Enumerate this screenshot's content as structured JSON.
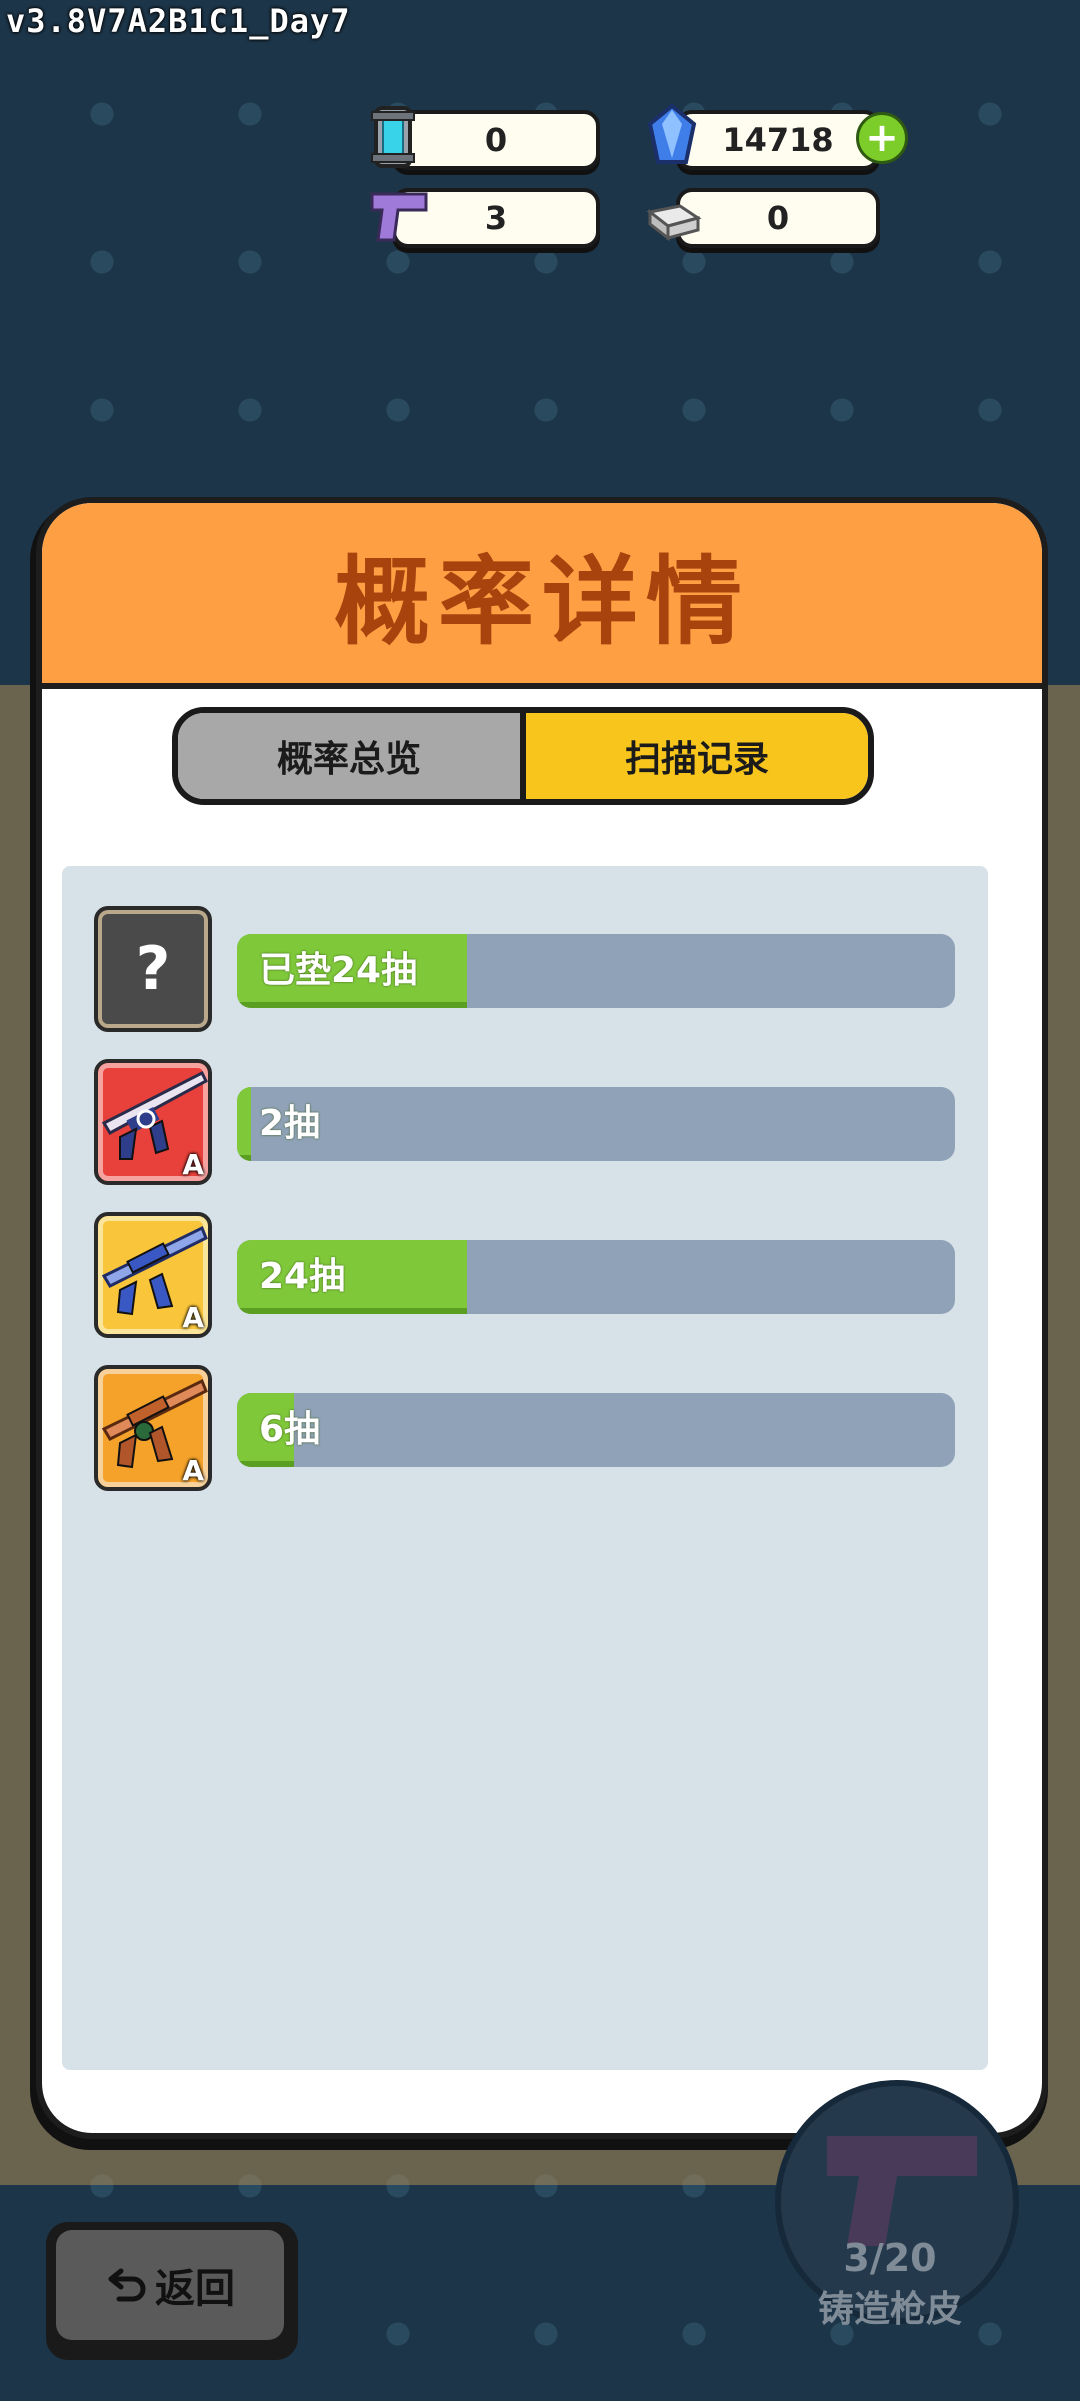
{
  "version": "v3.8V7A2B1C1_Day7",
  "currencies": {
    "capsule": {
      "icon": "energy-capsule-icon",
      "value": "0"
    },
    "gem": {
      "icon": "blue-gem-icon",
      "value": "14718"
    },
    "pistol": {
      "icon": "purple-pistol-icon",
      "value": "3"
    },
    "silver": {
      "icon": "silver-ingot-icon",
      "value": "0"
    }
  },
  "modal": {
    "title": "概率详情",
    "tabs": [
      {
        "label": "概率总览",
        "active": false
      },
      {
        "label": "扫描记录",
        "active": true
      }
    ],
    "records": [
      {
        "icon": "question-mark-icon",
        "label": "已垫24抽",
        "progress": 0.32
      },
      {
        "icon": "sniper-rifle-red-icon",
        "grade": "A",
        "label": "2抽",
        "progress": 0.02
      },
      {
        "icon": "sniper-rifle-gold-icon",
        "grade": "A",
        "label": "24抽",
        "progress": 0.32
      },
      {
        "icon": "sniper-rifle-orange-icon",
        "grade": "A",
        "label": "6抽",
        "progress": 0.08
      }
    ]
  },
  "back_button": {
    "label": "返回",
    "icon": "return-arrow-icon"
  },
  "forge": {
    "count": "3/20",
    "label": "铸造枪皮"
  },
  "colors": {
    "header": "#ff9f44",
    "tab_active": "#f7c51c",
    "bar_fill": "#7fc83a",
    "bar_track": "#8fa2b7"
  }
}
